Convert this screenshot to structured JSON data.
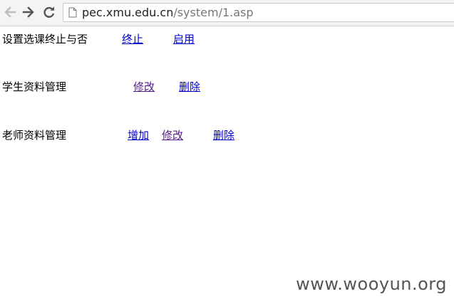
{
  "browser": {
    "url_host": "pec.xmu.edu.cn",
    "url_path": "/system/1.asp",
    "back_icon": "arrow-left-icon",
    "forward_icon": "arrow-right-icon",
    "reload_icon": "reload-icon",
    "page_icon": "page-icon"
  },
  "rows": [
    {
      "label": "设置选课终止与否",
      "links": [
        "终止",
        "启用"
      ]
    },
    {
      "label": "学生资料管理",
      "links": [
        "修改",
        " 删除"
      ]
    },
    {
      "label": "老师资料管理",
      "links": [
        " 增加",
        "修改",
        "删除"
      ]
    }
  ],
  "watermark": "www.wooyun.org",
  "colors": {
    "link": "#0000cc",
    "visited_link": "#551a8b"
  }
}
